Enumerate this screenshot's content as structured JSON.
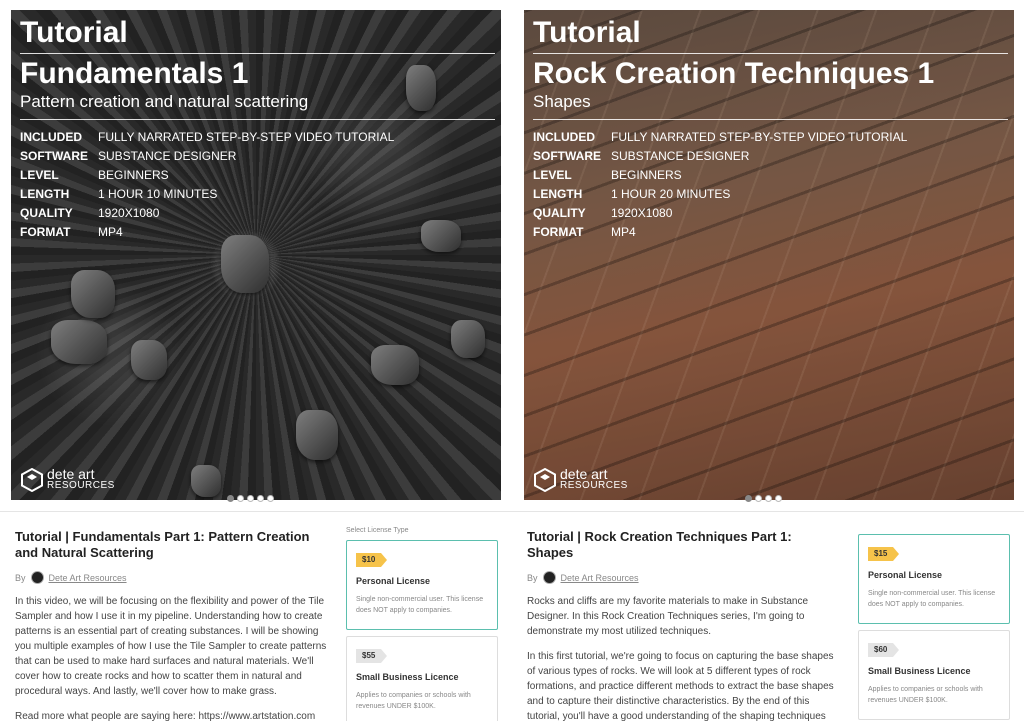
{
  "products": [
    {
      "hero": {
        "tutorial_label": "Tutorial",
        "title": "Fundamentals 1",
        "subtitle": "Pattern creation and natural scattering",
        "specs": [
          {
            "key": "INCLUDED",
            "value": "FULLY NARRATED STEP-BY-STEP VIDEO TUTORIAL"
          },
          {
            "key": "SOFTWARE",
            "value": "SUBSTANCE DESIGNER"
          },
          {
            "key": "LEVEL",
            "value": "BEGINNERS"
          },
          {
            "key": "LENGTH",
            "value": "1 HOUR 10 MINUTES"
          },
          {
            "key": "QUALITY",
            "value": "1920X1080"
          },
          {
            "key": "FORMAT",
            "value": "MP4"
          }
        ],
        "logo_name": "dete art",
        "logo_sub": "RESOURCES"
      },
      "carousel": {
        "total": 5,
        "active_index": 0
      },
      "info": {
        "title": "Tutorial | Fundamentals Part 1: Pattern Creation and Natural Scattering",
        "by_label": "By",
        "author": "Dete Art Resources",
        "paragraphs": [
          "In this video, we will be focusing on the flexibility and power of the Tile Sampler and how I use it in my pipeline. Understanding how to create patterns is an essential part of creating substances. I will be showing you multiple examples of how I use the Tile Sampler to create patterns that can be used to make hard surfaces and natural materials. We'll cover how to create rocks and how to scatter them in natural and procedural ways. And lastly, we'll cover how to make grass.",
          "Read more what people are saying here: https://www.artstation.com"
        ]
      },
      "licenses": {
        "label": "Select License Type",
        "options": [
          {
            "price": "$10",
            "name": "Personal License",
            "desc": "Single non-commercial user. This license does NOT apply to companies."
          },
          {
            "price": "$55",
            "name": "Small Business Licence",
            "desc": "Applies to companies or schools with revenues UNDER $100K."
          }
        ]
      }
    },
    {
      "hero": {
        "tutorial_label": "Tutorial",
        "title": "Rock Creation Techniques 1",
        "subtitle": "Shapes",
        "specs": [
          {
            "key": "INCLUDED",
            "value": "FULLY NARRATED STEP-BY-STEP VIDEO TUTORIAL"
          },
          {
            "key": "SOFTWARE",
            "value": "SUBSTANCE DESIGNER"
          },
          {
            "key": "LEVEL",
            "value": "BEGINNERS"
          },
          {
            "key": "LENGTH",
            "value": "1 HOUR 20 MINUTES"
          },
          {
            "key": "QUALITY",
            "value": "1920X1080"
          },
          {
            "key": "FORMAT",
            "value": "MP4"
          }
        ],
        "logo_name": "dete art",
        "logo_sub": "RESOURCES"
      },
      "carousel": {
        "total": 4,
        "active_index": 0
      },
      "info": {
        "title": "Tutorial | Rock Creation Techniques Part 1: Shapes",
        "by_label": "By",
        "author": "Dete Art Resources",
        "paragraphs": [
          "Rocks and cliffs are my favorite materials to make in Substance Designer. In this Rock Creation Techniques series, I'm going to demonstrate my most utilized techniques.",
          "In this first tutorial, we're going to focus on capturing the base shapes of various types of rocks. We will look at 5 different types of rock formations, and practice different methods to extract the base shapes and to capture their distinctive characteristics. By the end of this tutorial, you'll have a good understanding of the shaping techniques that I use in many of my rock projects."
        ]
      },
      "licenses": {
        "label": "",
        "options": [
          {
            "price": "$15",
            "name": "Personal License",
            "desc": "Single non-commercial user. This license does NOT apply to companies."
          },
          {
            "price": "$60",
            "name": "Small Business Licence",
            "desc": "Applies to companies or schools with revenues UNDER $100K."
          }
        ]
      }
    }
  ],
  "colors": {
    "selected_border": "#5bbfae",
    "price_tag_selected": "#f6c34a",
    "price_tag_default": "#e4e4e4"
  }
}
